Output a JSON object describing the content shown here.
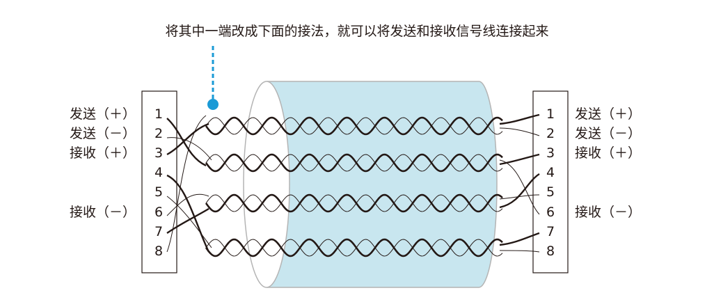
{
  "caption": "将其中一端改成下面的接法，就可以将发送和接收信号线连接起来",
  "left_connector": {
    "pins": [
      "1",
      "2",
      "3",
      "4",
      "5",
      "6",
      "7",
      "8"
    ],
    "labels": {
      "pin1": "发送（＋）",
      "pin2": "发送（－）",
      "pin3": "接收（＋）",
      "pin6": "接收（－）"
    }
  },
  "right_connector": {
    "pins": [
      "1",
      "2",
      "3",
      "4",
      "5",
      "6",
      "7",
      "8"
    ],
    "labels": {
      "pin1": "发送（＋）",
      "pin2": "发送（－）",
      "pin3": "接收（＋）",
      "pin6": "接收（－）"
    }
  },
  "colors": {
    "cable_fill": "#c8e6ef",
    "cable_edge": "#b4b4b4",
    "pointer": "#1a9ad6",
    "wire": "#231815"
  }
}
